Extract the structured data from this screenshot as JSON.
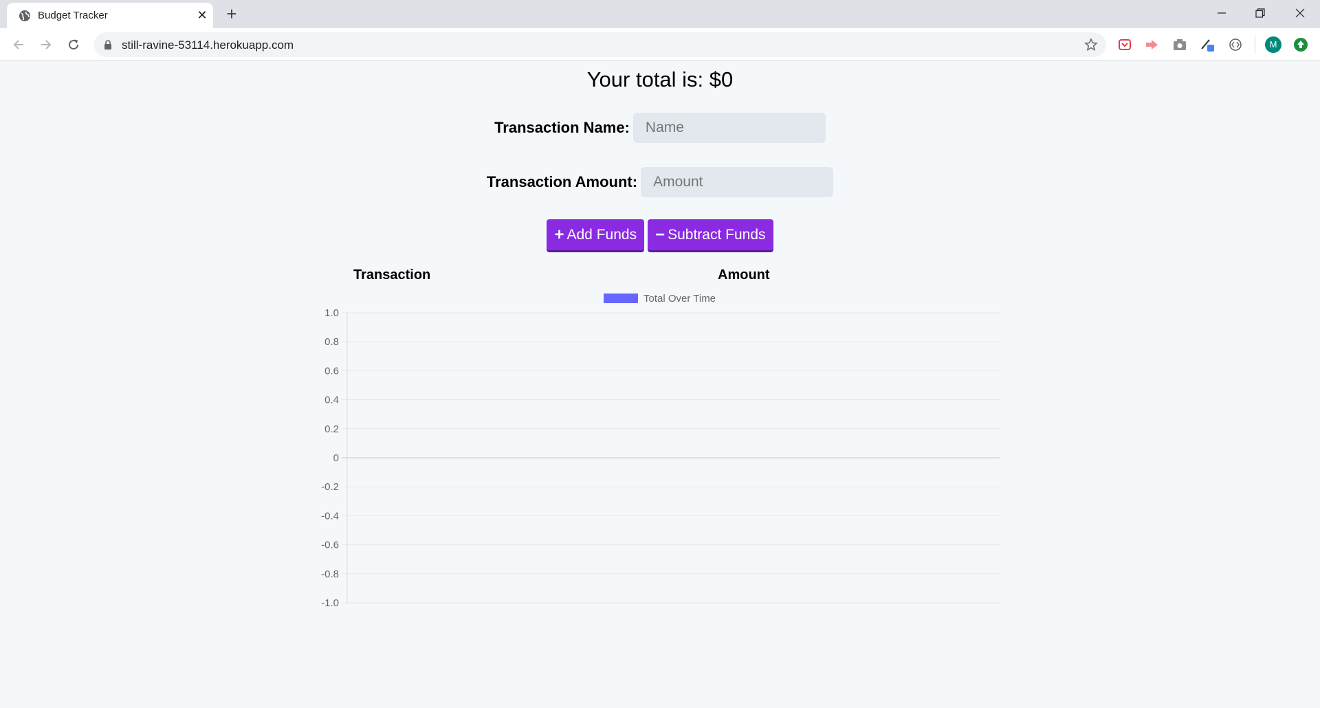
{
  "browser": {
    "tab_title": "Budget Tracker",
    "url": "still-ravine-53114.herokuapp.com",
    "profile_initial": "M"
  },
  "page": {
    "total_text": "Your total is: $0",
    "name_label": "Transaction Name:",
    "name_placeholder": "Name",
    "amount_label": "Transaction Amount:",
    "amount_placeholder": "Amount",
    "add_label": "Add Funds",
    "subtract_label": "Subtract Funds",
    "table_headers": [
      "Transaction",
      "Amount"
    ]
  },
  "colors": {
    "button": "#8a2be2",
    "series": "#6666ff"
  },
  "chart_data": {
    "type": "line",
    "legend": "Total Over Time",
    "legend_position": "top",
    "series": [
      {
        "name": "Total Over Time",
        "values": []
      }
    ],
    "yticks": [
      "1.0",
      "0.8",
      "0.6",
      "0.4",
      "0.2",
      "0",
      "-0.2",
      "-0.4",
      "-0.6",
      "-0.8",
      "-1.0"
    ],
    "ylim": [
      -1,
      1
    ],
    "grid": true
  }
}
